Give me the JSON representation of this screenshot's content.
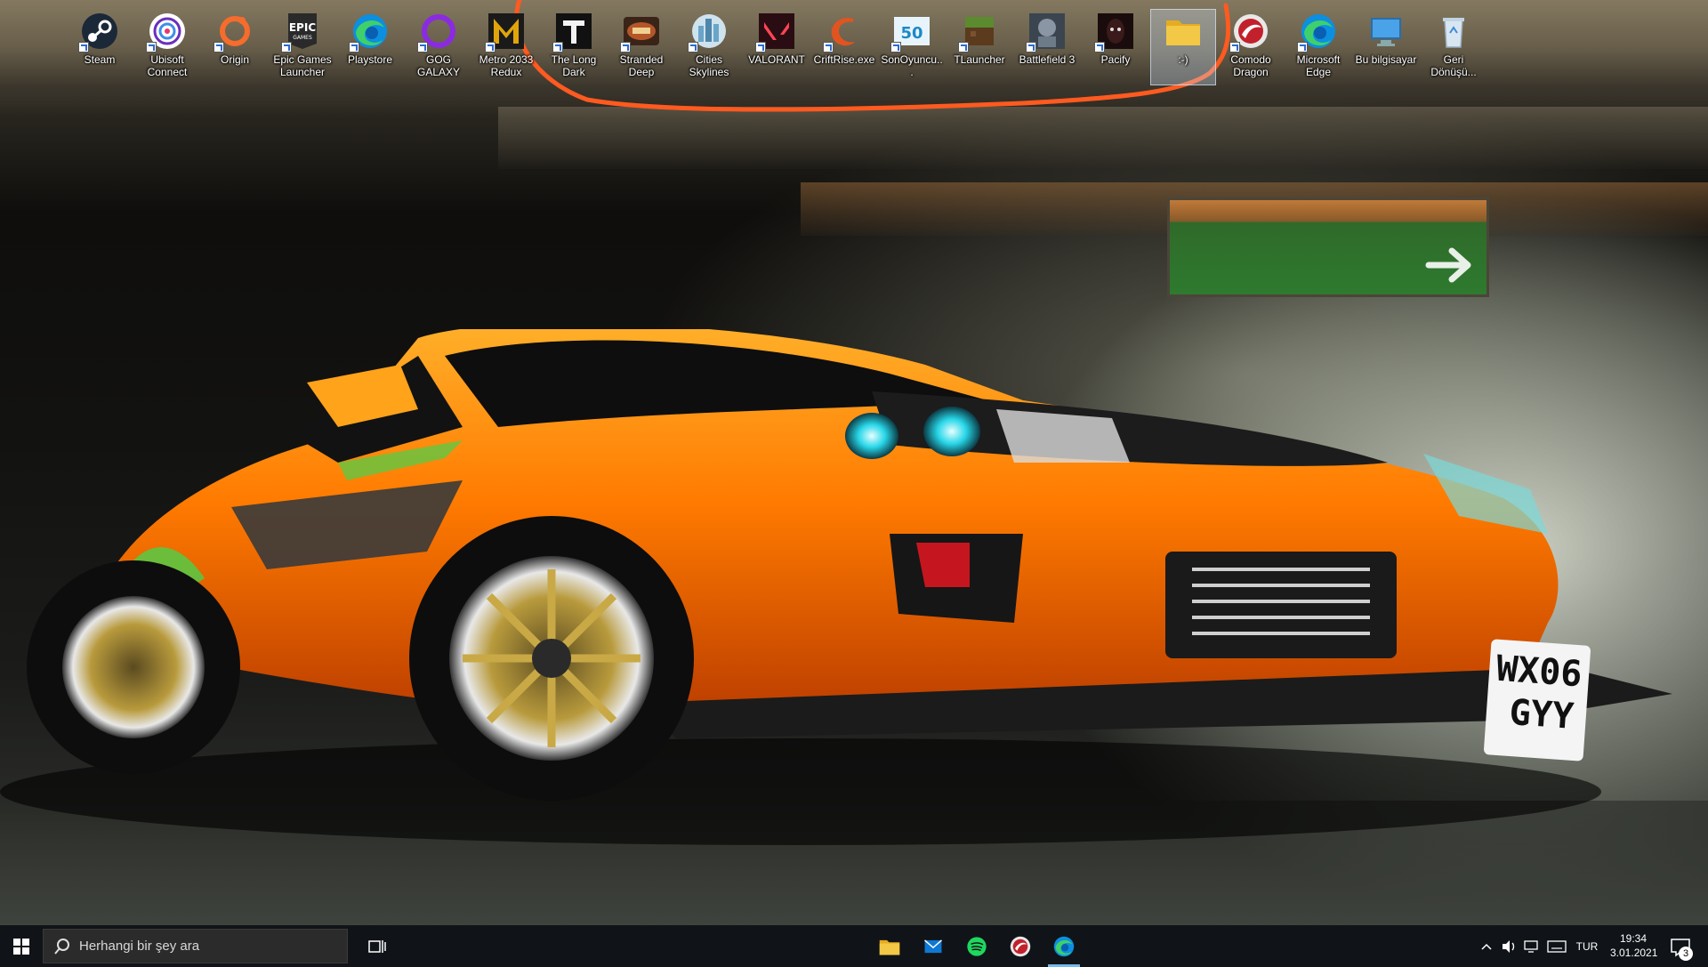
{
  "desktop": {
    "icons": [
      {
        "label": "Steam",
        "icon": "steam-icon",
        "color": "#1b2838"
      },
      {
        "label": "Ubisoft Connect",
        "icon": "ubisoft-icon",
        "color": "#ffffff"
      },
      {
        "label": "Origin",
        "icon": "origin-icon",
        "color": "#f56c2d"
      },
      {
        "label": "Epic Games Launcher",
        "icon": "epic-games-icon",
        "color": "#2a2a2a"
      },
      {
        "label": "Playstore",
        "icon": "edge-icon",
        "color": "#0c8fe0"
      },
      {
        "label": "GOG GALAXY",
        "icon": "gog-galaxy-icon",
        "color": "#8a2be2"
      },
      {
        "label": "Metro 2033 Redux",
        "icon": "metro-2033-icon",
        "color": "#e0a50b"
      },
      {
        "label": "The Long Dark",
        "icon": "the-long-dark-icon",
        "color": "#111111"
      },
      {
        "label": "Stranded Deep",
        "icon": "stranded-deep-icon",
        "color": "#b5562a"
      },
      {
        "label": "Cities Skylines",
        "icon": "cities-skylines-icon",
        "color": "#6aa5c8"
      },
      {
        "label": "VALORANT",
        "icon": "valorant-icon",
        "color": "#fd4556"
      },
      {
        "label": "CriftRise.exe",
        "icon": "criftrise-icon",
        "color": "#e2541f"
      },
      {
        "label": "SonOyuncu...",
        "icon": "sonoyuncu-icon",
        "color": "#1e88c8"
      },
      {
        "label": "TLauncher",
        "icon": "tlauncher-icon",
        "color": "#5b8a2f"
      },
      {
        "label": "Battlefield 3",
        "icon": "battlefield-3-icon",
        "color": "#6d7a88"
      },
      {
        "label": "Pacify",
        "icon": "pacify-icon",
        "color": "#3a1a1a"
      },
      {
        "label": ":-)",
        "icon": "folder-icon",
        "color": "#f3c846"
      },
      {
        "label": "Comodo Dragon",
        "icon": "comodo-dragon-icon",
        "color": "#c2212c"
      },
      {
        "label": "Microsoft Edge",
        "icon": "edge-icon",
        "color": "#0c8fe0"
      },
      {
        "label": "Bu bilgisayar",
        "icon": "this-pc-icon",
        "color": "#4aa3e8"
      },
      {
        "label": "Geri Dönüşü...",
        "icon": "recycle-bin-icon",
        "color": "#d8e6f2"
      }
    ],
    "highlight_color": "#ff5a1f"
  },
  "wallpaper": {
    "plate_line1": "WX06",
    "plate_line2": "GYY",
    "car_color": "#ff7a00"
  },
  "taskbar": {
    "search_placeholder": "Herhangi bir şey ara",
    "pinned": [
      {
        "name": "file-explorer",
        "icon": "folder-icon",
        "active": false
      },
      {
        "name": "mail",
        "icon": "mail-icon",
        "active": false
      },
      {
        "name": "spotify",
        "icon": "spotify-icon",
        "active": false
      },
      {
        "name": "comodo-dragon",
        "icon": "comodo-dragon-icon",
        "active": false
      },
      {
        "name": "microsoft-edge",
        "icon": "edge-icon",
        "active": true
      }
    ],
    "tray": {
      "language": "TUR"
    },
    "clock": {
      "time": "19:34",
      "date": "3.01.2021"
    },
    "notification_count": "3"
  }
}
